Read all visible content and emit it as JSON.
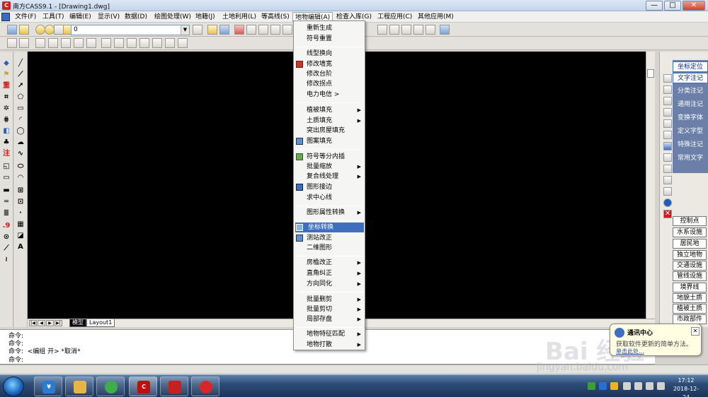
{
  "window": {
    "title": "南方CASS9.1 - [Drawing1.dwg]",
    "buttons": [
      "—",
      "□",
      "✕"
    ]
  },
  "menubar": {
    "items": [
      "文件(F)",
      "工具(T)",
      "编辑(E)",
      "显示(V)",
      "数据(D)",
      "绘图处理(W)",
      "地籍(J)",
      "土地利用(L)",
      "等高线(S)",
      "地物编辑(A)",
      "检查入库(G)",
      "工程应用(C)",
      "其他应用(M)"
    ],
    "active": "地物编辑(A)"
  },
  "toolbar": {
    "layer_value": "0"
  },
  "dropdown": {
    "items": [
      {
        "label": "重新生成",
        "submenu": false,
        "icon": ""
      },
      {
        "label": "符号重置",
        "submenu": false,
        "icon": ""
      },
      {
        "label": "线型换向",
        "submenu": false,
        "icon": ""
      },
      {
        "label": "修改墙宽",
        "submenu": false,
        "icon": "wall-width-icon"
      },
      {
        "label": "修改台阶",
        "submenu": false,
        "icon": ""
      },
      {
        "label": "修改拐点",
        "submenu": false,
        "icon": ""
      },
      {
        "label": "电力电信 >",
        "submenu": false,
        "icon": ""
      },
      {
        "label": "植被填充",
        "submenu": true,
        "icon": ""
      },
      {
        "label": "土质填充",
        "submenu": true,
        "icon": ""
      },
      {
        "label": "突出房屋填充",
        "submenu": false,
        "icon": ""
      },
      {
        "label": "图案填充",
        "submenu": false,
        "icon": "hatch-icon"
      },
      {
        "label": "符号等分内插",
        "submenu": false,
        "icon": "symbol-interp-icon"
      },
      {
        "label": "批量缩放",
        "submenu": true,
        "icon": ""
      },
      {
        "label": "复合线处理",
        "submenu": true,
        "icon": ""
      },
      {
        "label": "图形接边",
        "submenu": false,
        "icon": "edge-match-icon"
      },
      {
        "label": "求中心线",
        "submenu": false,
        "icon": ""
      },
      {
        "label": "图形属性转换",
        "submenu": true,
        "icon": ""
      },
      {
        "label": "坐标转换",
        "submenu": false,
        "icon": "coord-transform-icon"
      },
      {
        "label": "测站改正",
        "submenu": false,
        "icon": "station-correct-icon"
      },
      {
        "label": "二维图形",
        "submenu": false,
        "icon": ""
      },
      {
        "label": "房檐改正",
        "submenu": true,
        "icon": ""
      },
      {
        "label": "直角纠正",
        "submenu": true,
        "icon": ""
      },
      {
        "label": "方向同化",
        "submenu": true,
        "icon": ""
      },
      {
        "label": "批量删剪",
        "submenu": true,
        "icon": ""
      },
      {
        "label": "批量剪切",
        "submenu": true,
        "icon": ""
      },
      {
        "label": "局部存盘",
        "submenu": true,
        "icon": ""
      },
      {
        "label": "地物特征匹配",
        "submenu": true,
        "icon": ""
      },
      {
        "label": "地物打散",
        "submenu": true,
        "icon": ""
      }
    ],
    "highlighted": "坐标转换"
  },
  "layout_tabs": [
    "模型",
    "Layout1"
  ],
  "right_panel": {
    "tabs": [
      "坐标定位",
      "文字注记",
      "分类注记",
      "通用注记",
      "变换字体",
      "定义字型",
      "特殊注记",
      "常用文字"
    ],
    "selected": "文字注记",
    "buttons": [
      "控制点",
      "水系设施",
      "居民地",
      "独立地物",
      "交通设施",
      "管线设施",
      "境界线",
      "地貌土质",
      "植被土质",
      "市政部件"
    ]
  },
  "command": {
    "lines": [
      "命令:",
      "命令:",
      "命令:  <编组 开> *取消*",
      "命令:"
    ]
  },
  "notification": {
    "title": "通讯中心",
    "text": "获取软件更新的简单方法。",
    "link": "单击此处..."
  },
  "clock": {
    "time": "17:12",
    "date": "2018-12-24"
  },
  "watermark": {
    "brand": "Bai 经验",
    "url": "jingyan.baidu.com"
  },
  "colors": {
    "canvas": "#000000",
    "menu_highlight": "#3e6fbf",
    "right_panel_accent": "#3e6fbf"
  }
}
